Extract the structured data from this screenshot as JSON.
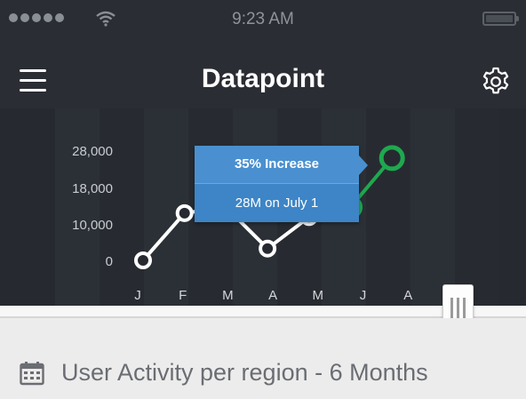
{
  "status_bar": {
    "time": "9:23 AM",
    "signal_icon": "signal-dots-icon",
    "wifi_icon": "wifi-icon",
    "battery_icon": "battery-icon"
  },
  "header": {
    "title": "Datapoint",
    "menu_icon": "hamburger-menu-icon",
    "settings_icon": "gear-icon"
  },
  "chart_data": {
    "type": "line",
    "categories": [
      "J",
      "F",
      "M",
      "A",
      "M",
      "J",
      "A"
    ],
    "y_tick_labels": [
      "28,000",
      "18,000",
      "10,000",
      "0"
    ],
    "y_tick_values": [
      28000,
      18000,
      10000,
      0
    ],
    "ylim": [
      0,
      28000
    ],
    "series": [
      {
        "values": [
          0,
          12000,
          13500,
          3000,
          11000,
          13500,
          26000
        ]
      }
    ],
    "highlight_from_index": 5,
    "grid": false,
    "colors": {
      "line": "#ffffff",
      "highlight": "#1fa84f",
      "background": "#262a30"
    }
  },
  "tooltip": {
    "title": "35% Increase",
    "detail": "28M on July 1",
    "color": "#4a90d0"
  },
  "footer": {
    "calendar_icon": "calendar-icon",
    "label": "User Activity per region - 6 Months"
  }
}
